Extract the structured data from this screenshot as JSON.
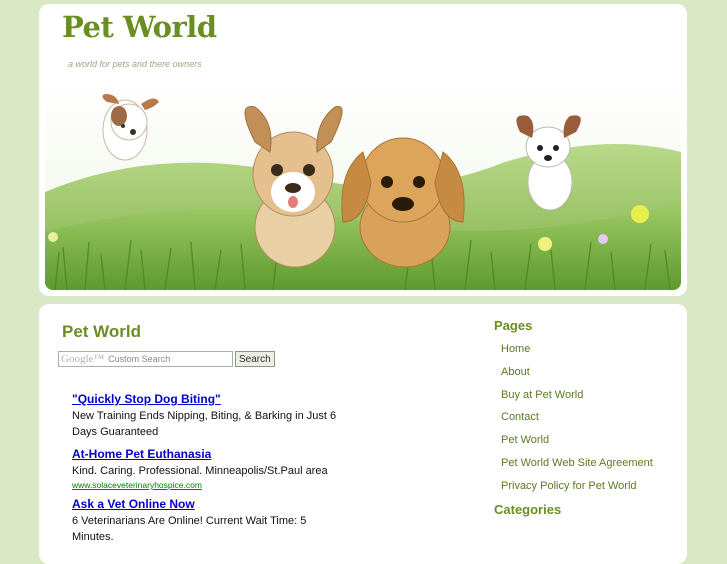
{
  "site": {
    "title": "Pet World",
    "tagline": "a world for pets and there owners"
  },
  "main": {
    "heading": "Pet World",
    "search": {
      "logo": "Google™",
      "placeholder": "Custom Search",
      "button_label": "Search"
    },
    "ads": [
      {
        "title": "\"Quickly Stop Dog Biting\"",
        "text": "New Training Ends Nipping, Biting, & Barking in Just 6 Days Guaranteed",
        "url": ""
      },
      {
        "title": "At-Home Pet Euthanasia",
        "text": "Kind. Caring. Professional. Minneapolis/St.Paul area",
        "url": "www.solaceveterinaryhospice.com"
      },
      {
        "title": "Ask a Vet Online Now",
        "text": "6 Veterinarians Are Online! Current Wait Time: 5 Minutes.",
        "url": ""
      }
    ]
  },
  "sidebar": {
    "pages_heading": "Pages",
    "pages": [
      "Home",
      "About",
      "Buy at Pet World",
      "Contact",
      "Pet World",
      "Pet World Web Site Agreement",
      "Privacy Policy for Pet World"
    ],
    "categories_heading": "Categories"
  },
  "colors": {
    "page_background": "#dbe8c6",
    "brand_green": "#6b8e23",
    "ad_link": "#0000cc",
    "ad_url": "#008000"
  }
}
